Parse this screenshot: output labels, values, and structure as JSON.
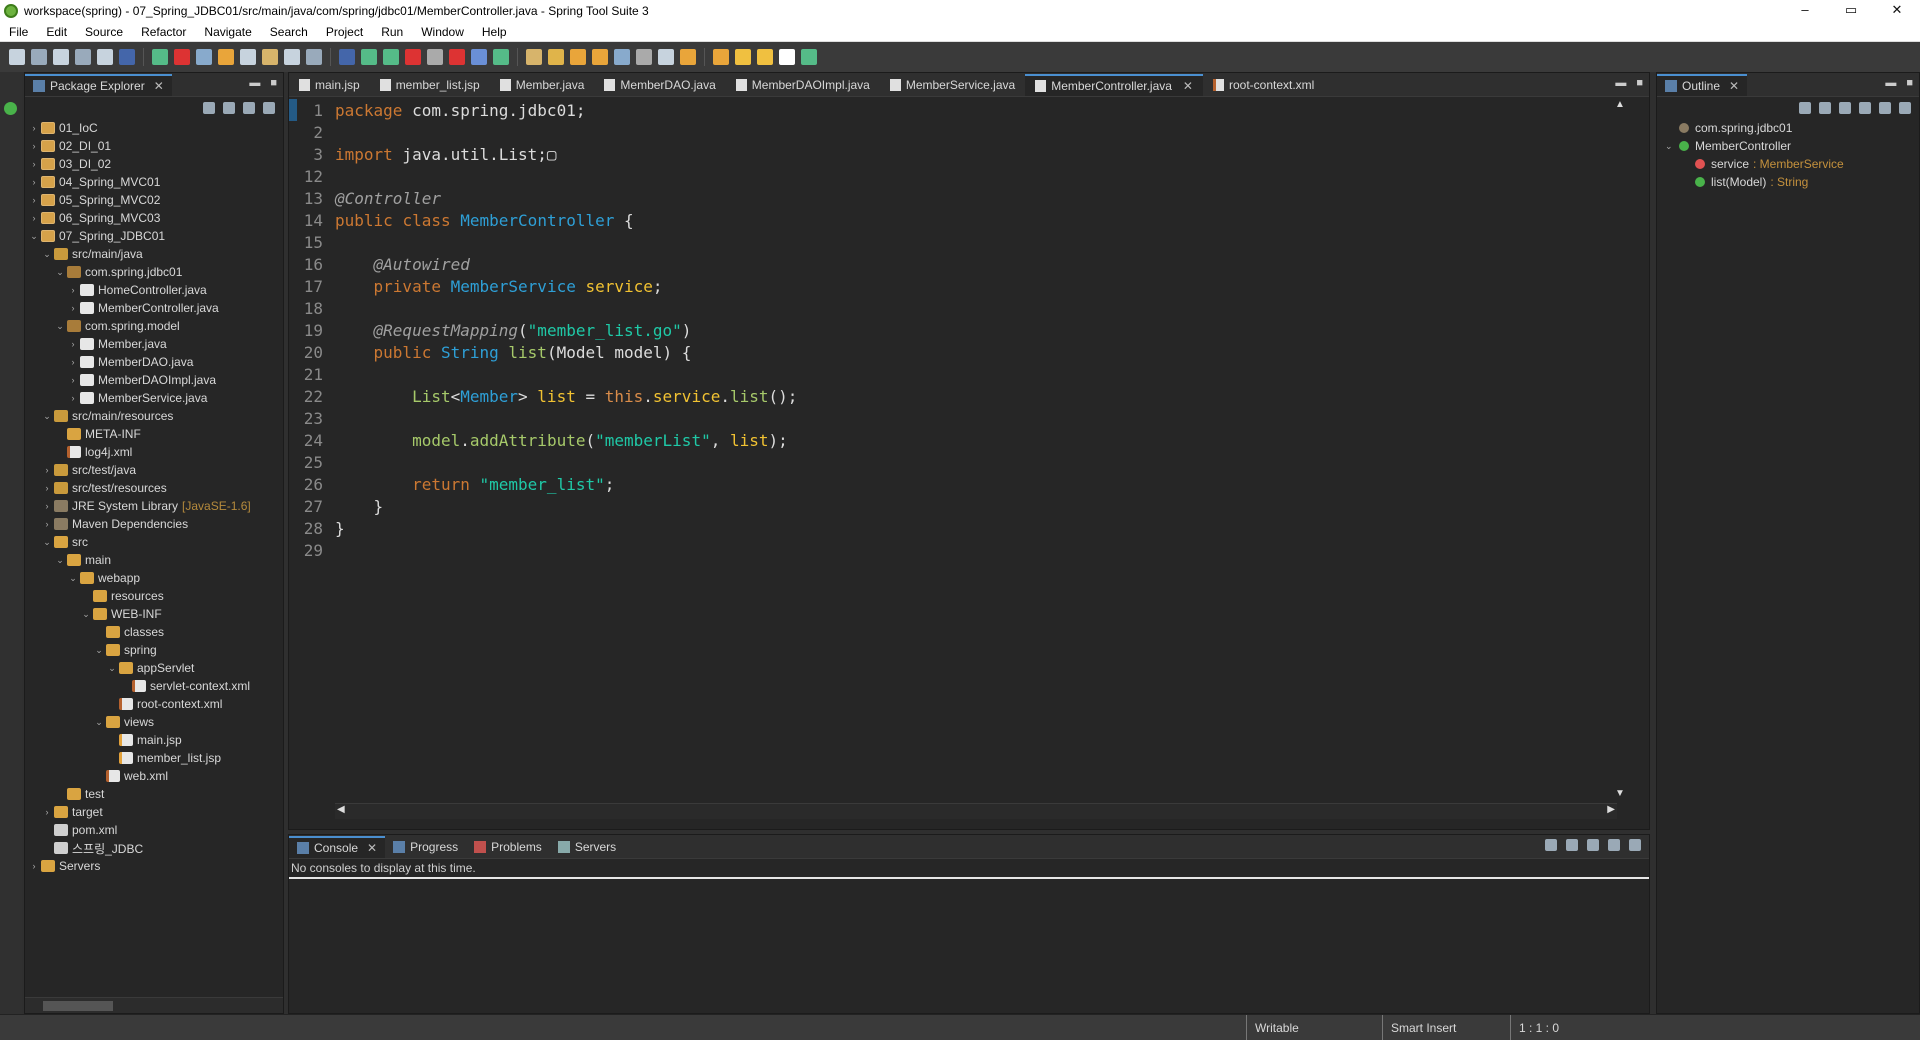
{
  "window": {
    "title": "workspace(spring) - 07_Spring_JDBC01/src/main/java/com/spring/jdbc01/MemberController.java - Spring Tool Suite 3",
    "minimize": "–",
    "restore": "▭",
    "close": "✕"
  },
  "menu": [
    "File",
    "Edit",
    "Source",
    "Refactor",
    "Navigate",
    "Search",
    "Project",
    "Run",
    "Window",
    "Help"
  ],
  "package_explorer": {
    "tab_label": "Package Explorer",
    "tree": [
      {
        "label": "01_IoC",
        "depth": 0,
        "arrow": "›",
        "icon": "proj"
      },
      {
        "label": "02_DI_01",
        "depth": 0,
        "arrow": "›",
        "icon": "proj"
      },
      {
        "label": "03_DI_02",
        "depth": 0,
        "arrow": "›",
        "icon": "proj"
      },
      {
        "label": "04_Spring_MVC01",
        "depth": 0,
        "arrow": "›",
        "icon": "proj"
      },
      {
        "label": "05_Spring_MVC02",
        "depth": 0,
        "arrow": "›",
        "icon": "proj"
      },
      {
        "label": "06_Spring_MVC03",
        "depth": 0,
        "arrow": "›",
        "icon": "proj"
      },
      {
        "label": "07_Spring_JDBC01",
        "depth": 0,
        "arrow": "⌄",
        "icon": "proj"
      },
      {
        "label": "src/main/java",
        "depth": 1,
        "arrow": "⌄",
        "icon": "src"
      },
      {
        "label": "com.spring.jdbc01",
        "depth": 2,
        "arrow": "⌄",
        "icon": "pkgi"
      },
      {
        "label": "HomeController.java",
        "depth": 3,
        "arrow": "›",
        "icon": "java"
      },
      {
        "label": "MemberController.java",
        "depth": 3,
        "arrow": "›",
        "icon": "java"
      },
      {
        "label": "com.spring.model",
        "depth": 2,
        "arrow": "⌄",
        "icon": "pkgi"
      },
      {
        "label": "Member.java",
        "depth": 3,
        "arrow": "›",
        "icon": "java"
      },
      {
        "label": "MemberDAO.java",
        "depth": 3,
        "arrow": "›",
        "icon": "java"
      },
      {
        "label": "MemberDAOImpl.java",
        "depth": 3,
        "arrow": "›",
        "icon": "java"
      },
      {
        "label": "MemberService.java",
        "depth": 3,
        "arrow": "›",
        "icon": "java"
      },
      {
        "label": "src/main/resources",
        "depth": 1,
        "arrow": "⌄",
        "icon": "src"
      },
      {
        "label": "META-INF",
        "depth": 2,
        "arrow": "",
        "icon": "folder"
      },
      {
        "label": "log4j.xml",
        "depth": 2,
        "arrow": "",
        "icon": "xml"
      },
      {
        "label": "src/test/java",
        "depth": 1,
        "arrow": "›",
        "icon": "src"
      },
      {
        "label": "src/test/resources",
        "depth": 1,
        "arrow": "›",
        "icon": "src"
      },
      {
        "label": "JRE System Library",
        "extra": "[JavaSE-1.6]",
        "depth": 1,
        "arrow": "›",
        "icon": "lib"
      },
      {
        "label": "Maven Dependencies",
        "depth": 1,
        "arrow": "›",
        "icon": "lib"
      },
      {
        "label": "src",
        "depth": 1,
        "arrow": "⌄",
        "icon": "folder"
      },
      {
        "label": "main",
        "depth": 2,
        "arrow": "⌄",
        "icon": "folder"
      },
      {
        "label": "webapp",
        "depth": 3,
        "arrow": "⌄",
        "icon": "folder"
      },
      {
        "label": "resources",
        "depth": 4,
        "arrow": "",
        "icon": "folder"
      },
      {
        "label": "WEB-INF",
        "depth": 4,
        "arrow": "⌄",
        "icon": "folder"
      },
      {
        "label": "classes",
        "depth": 5,
        "arrow": "",
        "icon": "folder"
      },
      {
        "label": "spring",
        "depth": 5,
        "arrow": "⌄",
        "icon": "folder"
      },
      {
        "label": "appServlet",
        "depth": 6,
        "arrow": "⌄",
        "icon": "folder"
      },
      {
        "label": "servlet-context.xml",
        "depth": 7,
        "arrow": "",
        "icon": "xml"
      },
      {
        "label": "root-context.xml",
        "depth": 6,
        "arrow": "",
        "icon": "xml"
      },
      {
        "label": "views",
        "depth": 5,
        "arrow": "⌄",
        "icon": "folder"
      },
      {
        "label": "main.jsp",
        "depth": 6,
        "arrow": "",
        "icon": "jsp"
      },
      {
        "label": "member_list.jsp",
        "depth": 6,
        "arrow": "",
        "icon": "jsp"
      },
      {
        "label": "web.xml",
        "depth": 5,
        "arrow": "",
        "icon": "xml"
      },
      {
        "label": "test",
        "depth": 2,
        "arrow": "",
        "icon": "folder"
      },
      {
        "label": "target",
        "depth": 1,
        "arrow": "›",
        "icon": "folder"
      },
      {
        "label": "pom.xml",
        "depth": 1,
        "arrow": "",
        "icon": "file"
      },
      {
        "label": "스프링_JDBC",
        "depth": 1,
        "arrow": "",
        "icon": "file"
      },
      {
        "label": "Servers",
        "depth": 0,
        "arrow": "›",
        "icon": "folder"
      }
    ]
  },
  "editor": {
    "tabs": [
      {
        "label": "main.jsp",
        "active": false,
        "icon": "jsp"
      },
      {
        "label": "member_list.jsp",
        "active": false,
        "icon": "jsp"
      },
      {
        "label": "Member.java",
        "active": false,
        "icon": "java"
      },
      {
        "label": "MemberDAO.java",
        "active": false,
        "icon": "java"
      },
      {
        "label": "MemberDAOImpl.java",
        "active": false,
        "icon": "java"
      },
      {
        "label": "MemberService.java",
        "active": false,
        "icon": "java"
      },
      {
        "label": "MemberController.java",
        "active": true,
        "icon": "java"
      },
      {
        "label": "root-context.xml",
        "active": false,
        "icon": "xml"
      }
    ],
    "lines": [
      {
        "n": "1",
        "fold": false,
        "parts": [
          [
            "kw",
            "package"
          ],
          [
            "pl",
            " com.spring.jdbc01;"
          ]
        ]
      },
      {
        "n": "2",
        "fold": false,
        "parts": []
      },
      {
        "n": "3",
        "fold": true,
        "parts": [
          [
            "kw",
            "import"
          ],
          [
            "pl",
            " java.util.List;"
          ],
          [
            "pl",
            "▢"
          ]
        ]
      },
      {
        "n": "12",
        "fold": false,
        "parts": []
      },
      {
        "n": "13",
        "fold": false,
        "parts": [
          [
            "ann",
            "@Controller"
          ]
        ]
      },
      {
        "n": "14",
        "fold": false,
        "parts": [
          [
            "kw",
            "public"
          ],
          [
            "pl",
            " "
          ],
          [
            "kw",
            "class"
          ],
          [
            "pl",
            " "
          ],
          [
            "ty",
            "MemberController"
          ],
          [
            "pl",
            " {"
          ]
        ]
      },
      {
        "n": "15",
        "fold": false,
        "parts": []
      },
      {
        "n": "16",
        "fold": true,
        "parts": [
          [
            "pl",
            "    "
          ],
          [
            "ann",
            "@Autowired"
          ]
        ]
      },
      {
        "n": "17",
        "fold": false,
        "parts": [
          [
            "pl",
            "    "
          ],
          [
            "kw",
            "private"
          ],
          [
            "pl",
            " "
          ],
          [
            "ty",
            "MemberService"
          ],
          [
            "pl",
            " "
          ],
          [
            "fd",
            "service"
          ],
          [
            "pl",
            ";"
          ]
        ]
      },
      {
        "n": "18",
        "fold": false,
        "parts": []
      },
      {
        "n": "19",
        "fold": true,
        "parts": [
          [
            "pl",
            "    "
          ],
          [
            "ann",
            "@RequestMapping"
          ],
          [
            "pl",
            "("
          ],
          [
            "st",
            "\"member_list.go\""
          ],
          [
            "pl",
            ")"
          ]
        ]
      },
      {
        "n": "20",
        "fold": false,
        "parts": [
          [
            "pl",
            "    "
          ],
          [
            "kw",
            "public"
          ],
          [
            "pl",
            " "
          ],
          [
            "ty",
            "String"
          ],
          [
            "pl",
            " "
          ],
          [
            "fn",
            "list"
          ],
          [
            "pl",
            "(Model model) {"
          ]
        ]
      },
      {
        "n": "21",
        "fold": false,
        "parts": []
      },
      {
        "n": "22",
        "fold": false,
        "parts": [
          [
            "pl",
            "        "
          ],
          [
            "fn",
            "List"
          ],
          [
            "pl",
            "<"
          ],
          [
            "ty",
            "Member"
          ],
          [
            "pl",
            "> "
          ],
          [
            "fd",
            "list"
          ],
          [
            "pl",
            " = "
          ],
          [
            "this",
            "this"
          ],
          [
            "pl",
            "."
          ],
          [
            "fd",
            "service"
          ],
          [
            "pl",
            "."
          ],
          [
            "fn",
            "list"
          ],
          [
            "pl",
            "();"
          ]
        ]
      },
      {
        "n": "23",
        "fold": false,
        "parts": []
      },
      {
        "n": "24",
        "fold": false,
        "parts": [
          [
            "pl",
            "        "
          ],
          [
            "fn",
            "model"
          ],
          [
            "pl",
            "."
          ],
          [
            "fn",
            "addAttribute"
          ],
          [
            "pl",
            "("
          ],
          [
            "st",
            "\"memberList\""
          ],
          [
            "pl",
            ", "
          ],
          [
            "fd",
            "list"
          ],
          [
            "pl",
            ");"
          ]
        ]
      },
      {
        "n": "25",
        "fold": false,
        "parts": []
      },
      {
        "n": "26",
        "fold": false,
        "parts": [
          [
            "pl",
            "        "
          ],
          [
            "kw",
            "return"
          ],
          [
            "pl",
            " "
          ],
          [
            "st",
            "\"member_list\""
          ],
          [
            "pl",
            ";"
          ]
        ]
      },
      {
        "n": "27",
        "fold": false,
        "parts": [
          [
            "pl",
            "    }"
          ]
        ]
      },
      {
        "n": "28",
        "fold": false,
        "parts": [
          [
            "pl",
            "}"
          ]
        ]
      },
      {
        "n": "29",
        "fold": false,
        "parts": []
      }
    ]
  },
  "outline": {
    "tab_label": "Outline",
    "items": [
      {
        "label": "com.spring.jdbc01",
        "type": "",
        "indent": 0,
        "icon": "#8a7b62",
        "arrow": ""
      },
      {
        "label": "MemberController",
        "type": "",
        "indent": 0,
        "icon": "#49b24a",
        "arrow": "⌄"
      },
      {
        "label": "service",
        "type": ": MemberService",
        "indent": 1,
        "icon": "#e05252",
        "arrow": ""
      },
      {
        "label": "list(Model)",
        "type": ": String",
        "indent": 1,
        "icon": "#49b24a",
        "arrow": ""
      }
    ]
  },
  "bottom_panel": {
    "tabs": [
      {
        "label": "Console",
        "active": true
      },
      {
        "label": "Progress",
        "active": false
      },
      {
        "label": "Problems",
        "active": false
      },
      {
        "label": "Servers",
        "active": false
      }
    ],
    "message": "No consoles to display at this time."
  },
  "status": {
    "writable": "Writable",
    "insert_mode": "Smart Insert",
    "position": "1 : 1 : 0"
  },
  "colors": {
    "accent": "#4a8fd0",
    "keyword": "#cc7832",
    "type": "#2e9fd6",
    "string": "#1fc9a7"
  }
}
